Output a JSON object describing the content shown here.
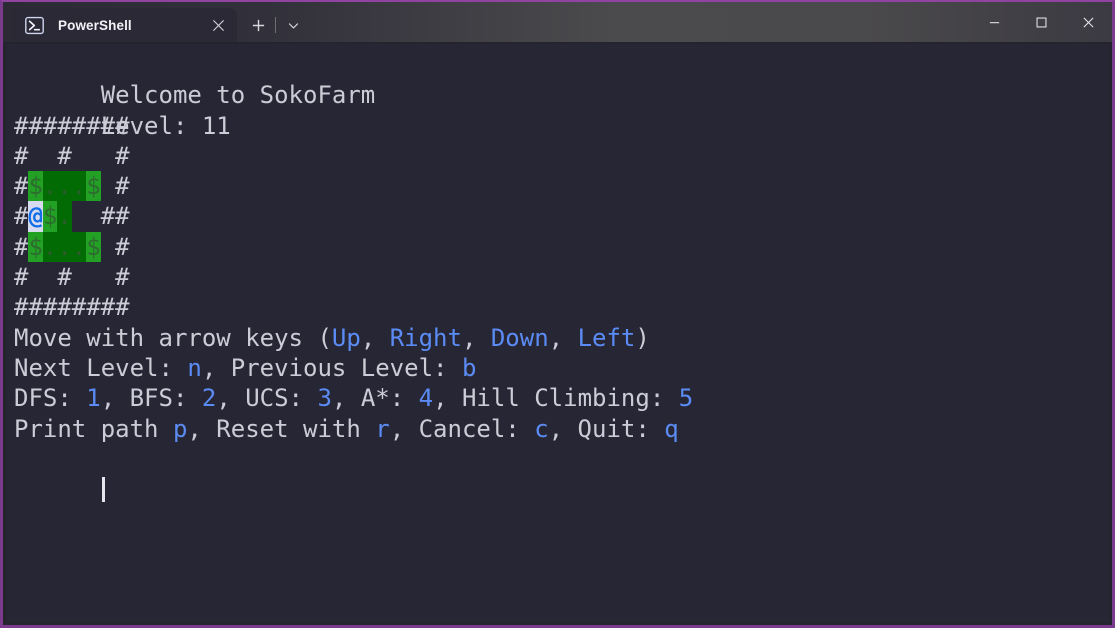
{
  "window": {
    "accent_border_color": "#7a3b8c",
    "titlebar_controls": [
      {
        "name": "minimize",
        "glyph": "minimize-icon"
      },
      {
        "name": "maximize",
        "glyph": "maximize-icon"
      },
      {
        "name": "close",
        "glyph": "close-icon"
      }
    ]
  },
  "tab": {
    "title": "PowerShell",
    "icon": "powershell-icon",
    "close_glyph": "close-icon",
    "new_tab_glyph": "plus-icon",
    "dropdown_glyph": "chevron-down-icon"
  },
  "terminal": {
    "background_color": "#272635",
    "foreground_color": "#ccccd6",
    "accent_color": "#5b8cf5",
    "box_color": "#23a125",
    "floor_color": "#036b03",
    "player_bg_color": "#d8dbf0",
    "player_fg_color": "#0f6ee8",
    "header": {
      "welcome": "Welcome to SokoFarm",
      "level_label": "Level: ",
      "level_value": "11"
    },
    "board": {
      "wall_char": "#",
      "box_char": "$",
      "player_char": "@",
      "goal_char": ".",
      "empty_char": " ",
      "rows": [
        "########",
        "#  #   #",
        "# $  $ #",
        "#@$.   ##",
        "# $  $ #",
        "#  #   #",
        "########"
      ],
      "cells": [
        [
          {
            "t": "wall",
            "c": "#"
          },
          {
            "t": "wall",
            "c": "#"
          },
          {
            "t": "wall",
            "c": "#"
          },
          {
            "t": "wall",
            "c": "#"
          },
          {
            "t": "wall",
            "c": "#"
          },
          {
            "t": "wall",
            "c": "#"
          },
          {
            "t": "wall",
            "c": "#"
          },
          {
            "t": "wall",
            "c": "#"
          }
        ],
        [
          {
            "t": "wall",
            "c": "#"
          },
          {
            "t": "void",
            "c": " "
          },
          {
            "t": "void",
            "c": " "
          },
          {
            "t": "wall",
            "c": "#"
          },
          {
            "t": "void",
            "c": " "
          },
          {
            "t": "void",
            "c": " "
          },
          {
            "t": "void",
            "c": " "
          },
          {
            "t": "wall",
            "c": "#"
          }
        ],
        [
          {
            "t": "wall",
            "c": "#"
          },
          {
            "t": "box",
            "c": "$"
          },
          {
            "t": "floor-goal",
            "c": "."
          },
          {
            "t": "floor-goal",
            "c": "."
          },
          {
            "t": "floor-goal",
            "c": "."
          },
          {
            "t": "box",
            "c": "$"
          },
          {
            "t": "void",
            "c": " "
          },
          {
            "t": "wall",
            "c": "#"
          }
        ],
        [
          {
            "t": "wall",
            "c": "#"
          },
          {
            "t": "player",
            "c": "@"
          },
          {
            "t": "box",
            "c": "$"
          },
          {
            "t": "floor-goal",
            "c": "."
          },
          {
            "t": "void",
            "c": " "
          },
          {
            "t": "void",
            "c": " "
          },
          {
            "t": "wall",
            "c": "#"
          },
          {
            "t": "wall",
            "c": "#"
          }
        ],
        [
          {
            "t": "wall",
            "c": "#"
          },
          {
            "t": "box",
            "c": "$"
          },
          {
            "t": "floor-goal",
            "c": "."
          },
          {
            "t": "floor-goal",
            "c": "."
          },
          {
            "t": "floor-goal",
            "c": "."
          },
          {
            "t": "box",
            "c": "$"
          },
          {
            "t": "void",
            "c": " "
          },
          {
            "t": "wall",
            "c": "#"
          }
        ],
        [
          {
            "t": "wall",
            "c": "#"
          },
          {
            "t": "void",
            "c": " "
          },
          {
            "t": "void",
            "c": " "
          },
          {
            "t": "wall",
            "c": "#"
          },
          {
            "t": "void",
            "c": " "
          },
          {
            "t": "void",
            "c": " "
          },
          {
            "t": "void",
            "c": " "
          },
          {
            "t": "wall",
            "c": "#"
          }
        ],
        [
          {
            "t": "wall",
            "c": "#"
          },
          {
            "t": "wall",
            "c": "#"
          },
          {
            "t": "wall",
            "c": "#"
          },
          {
            "t": "wall",
            "c": "#"
          },
          {
            "t": "wall",
            "c": "#"
          },
          {
            "t": "wall",
            "c": "#"
          },
          {
            "t": "wall",
            "c": "#"
          },
          {
            "t": "wall",
            "c": "#"
          }
        ]
      ]
    },
    "help": [
      [
        {
          "text": "Move with arrow keys ",
          "k": false
        },
        {
          "text": "(",
          "k": false
        },
        {
          "text": "Up",
          "k": true
        },
        {
          "text": ", ",
          "k": false
        },
        {
          "text": "Right",
          "k": true
        },
        {
          "text": ", ",
          "k": false
        },
        {
          "text": "Down",
          "k": true
        },
        {
          "text": ", ",
          "k": false
        },
        {
          "text": "Left",
          "k": true
        },
        {
          "text": ")",
          "k": false
        }
      ],
      [
        {
          "text": "Next Level: ",
          "k": false
        },
        {
          "text": "n",
          "k": true
        },
        {
          "text": ", Previous Level: ",
          "k": false
        },
        {
          "text": "b",
          "k": true
        }
      ],
      [
        {
          "text": "DFS: ",
          "k": false
        },
        {
          "text": "1",
          "k": true
        },
        {
          "text": ", BFS: ",
          "k": false
        },
        {
          "text": "2",
          "k": true
        },
        {
          "text": ", UCS: ",
          "k": false
        },
        {
          "text": "3",
          "k": true
        },
        {
          "text": ", A*: ",
          "k": false
        },
        {
          "text": "4",
          "k": true
        },
        {
          "text": ", Hill Climbing: ",
          "k": false
        },
        {
          "text": "5",
          "k": true
        }
      ],
      [
        {
          "text": "Print path ",
          "k": false
        },
        {
          "text": "p",
          "k": true
        },
        {
          "text": ", Reset with ",
          "k": false
        },
        {
          "text": "r",
          "k": true
        },
        {
          "text": ", Cancel: ",
          "k": false
        },
        {
          "text": "c",
          "k": true
        },
        {
          "text": ", Quit: ",
          "k": false
        },
        {
          "text": "q",
          "k": true
        }
      ]
    ]
  }
}
